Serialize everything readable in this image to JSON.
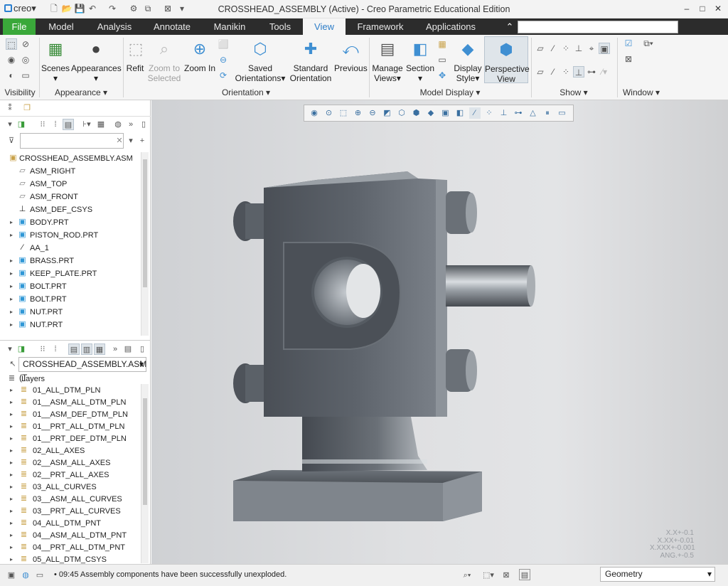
{
  "app": {
    "logo": "creo",
    "title": "CROSSHEAD_ASSEMBLY (Active) - Creo Parametric Educational Edition"
  },
  "titlebar": {
    "minimize": "–",
    "maximize": "□",
    "close": "✕"
  },
  "tabs": [
    "File",
    "Model",
    "Analysis",
    "Annotate",
    "Manikin",
    "Tools",
    "View",
    "Framework",
    "Applications"
  ],
  "active_tab": "View",
  "ribbon": {
    "visibility": "Visibility",
    "scenes": "Scenes",
    "appearances": "Appearances",
    "appearance_group": "Appearance",
    "refit": "Refit",
    "zoom_selected": [
      "Zoom to",
      "Selected"
    ],
    "zoom_in": "Zoom In",
    "saved_orient": [
      "Saved",
      "Orientations"
    ],
    "standard_orient": [
      "Standard",
      "Orientation"
    ],
    "previous": "Previous",
    "orientation_group": "Orientation",
    "manage_views": [
      "Manage",
      "Views"
    ],
    "section": "Section",
    "display_style": [
      "Display",
      "Style"
    ],
    "perspective": [
      "Perspective",
      "View"
    ],
    "model_display_group": "Model Display",
    "show_group": "Show",
    "window_group": "Window"
  },
  "tree": {
    "root": "CROSSHEAD_ASSEMBLY.ASM",
    "items": [
      {
        "label": "ASM_RIGHT",
        "kind": "plane"
      },
      {
        "label": "ASM_TOP",
        "kind": "plane"
      },
      {
        "label": "ASM_FRONT",
        "kind": "plane"
      },
      {
        "label": "ASM_DEF_CSYS",
        "kind": "csys"
      },
      {
        "label": "BODY.PRT",
        "kind": "part"
      },
      {
        "label": "PISTON_ROD.PRT",
        "kind": "part"
      },
      {
        "label": "AA_1",
        "kind": "axis"
      },
      {
        "label": "BRASS.PRT",
        "kind": "part"
      },
      {
        "label": "KEEP_PLATE.PRT",
        "kind": "part"
      },
      {
        "label": "BOLT.PRT",
        "kind": "part"
      },
      {
        "label": "BOLT.PRT",
        "kind": "part"
      },
      {
        "label": "NUT.PRT",
        "kind": "part"
      },
      {
        "label": "NUT.PRT",
        "kind": "part"
      }
    ]
  },
  "layers": {
    "assembly_select": "CROSSHEAD_ASSEMBLY.ASM (T",
    "header": "Layers",
    "items": [
      "01_ALL_DTM_PLN",
      "01__ASM_ALL_DTM_PLN",
      "01__ASM_DEF_DTM_PLN",
      "01__PRT_ALL_DTM_PLN",
      "01__PRT_DEF_DTM_PLN",
      "02_ALL_AXES",
      "02__ASM_ALL_AXES",
      "02__PRT_ALL_AXES",
      "03_ALL_CURVES",
      "03__ASM_ALL_CURVES",
      "03__PRT_ALL_CURVES",
      "04_ALL_DTM_PNT",
      "04__ASM_ALL_DTM_PNT",
      "04__PRT_ALL_DTM_PNT",
      "05_ALL_DTM_CSYS"
    ]
  },
  "legend": [
    "X.X+-0.1",
    "X.XX+-0.01",
    "X.XXX+-0.001",
    "ANG.+-0.5"
  ],
  "status": {
    "message": "09:45 Assembly components have been successfully unexploded.",
    "filter": "Geometry"
  }
}
